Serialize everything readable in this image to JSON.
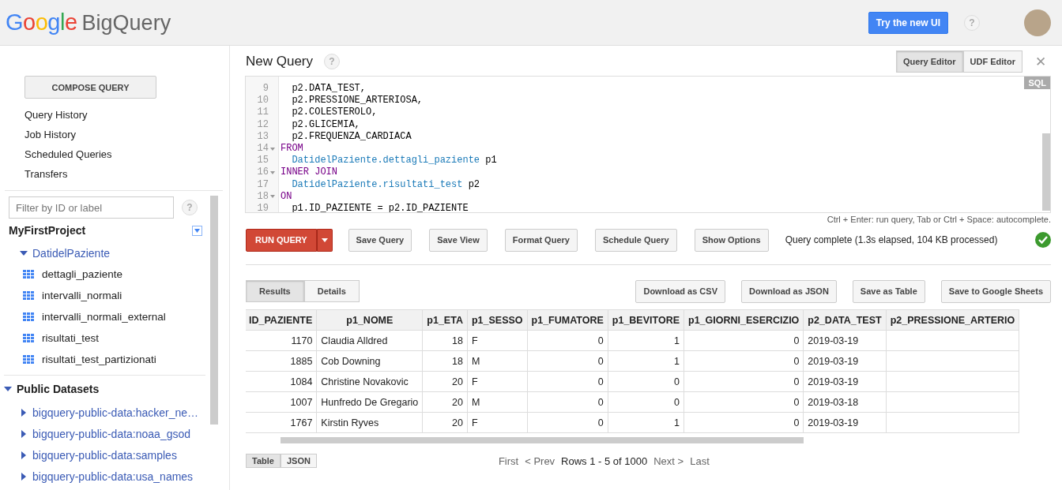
{
  "header": {
    "logo_google": "Google",
    "logo_product": "BigQuery",
    "try_button": "Try the new UI",
    "help": "?"
  },
  "sidebar": {
    "compose": "COMPOSE QUERY",
    "nav": [
      "Query History",
      "Job History",
      "Scheduled Queries",
      "Transfers"
    ],
    "filter_placeholder": "Filter by ID or label",
    "help": "?",
    "project": {
      "name": "MyFirstProject",
      "datasets": [
        {
          "name": "DatidelPaziente",
          "expanded": true,
          "tables": [
            "dettagli_paziente",
            "intervalli_normali",
            "intervalli_normali_external",
            "risultati_test",
            "risultati_test_partizionati"
          ]
        }
      ]
    },
    "public": {
      "title": "Public Datasets",
      "expanded": true,
      "datasets": [
        {
          "name": "bigquery-public-data:hacker_ne…",
          "expanded": false
        },
        {
          "name": "bigquery-public-data:noaa_gsod",
          "expanded": false
        },
        {
          "name": "bigquery-public-data:samples",
          "expanded": false
        },
        {
          "name": "bigquery-public-data:usa_names",
          "expanded": false
        }
      ]
    }
  },
  "editor": {
    "title": "New Query",
    "help": "?",
    "tabs": [
      {
        "label": "Query Editor",
        "selected": true
      },
      {
        "label": "UDF Editor",
        "selected": false
      }
    ],
    "close": "✕",
    "mode": "SQL",
    "lines": [
      {
        "n": "9",
        "fold": false,
        "parts": [
          {
            "kind": "plain",
            "text": "  p2.DATA_TEST,"
          }
        ]
      },
      {
        "n": "10",
        "fold": false,
        "parts": [
          {
            "kind": "plain",
            "text": "  p2.PRESSIONE_ARTERIOSA,"
          }
        ]
      },
      {
        "n": "11",
        "fold": false,
        "parts": [
          {
            "kind": "plain",
            "text": "  p2.COLESTEROLO,"
          }
        ]
      },
      {
        "n": "12",
        "fold": false,
        "parts": [
          {
            "kind": "plain",
            "text": "  p2.GLICEMIA,"
          }
        ]
      },
      {
        "n": "13",
        "fold": false,
        "parts": [
          {
            "kind": "plain",
            "text": "  p2.FREQUENZA_CARDIACA"
          }
        ]
      },
      {
        "n": "14",
        "fold": true,
        "parts": [
          {
            "kind": "keyword",
            "text": "FROM"
          }
        ]
      },
      {
        "n": "15",
        "fold": false,
        "parts": [
          {
            "kind": "table",
            "text": "  DatidelPaziente.dettagli_paziente"
          },
          {
            "kind": "plain",
            "text": " p1"
          }
        ]
      },
      {
        "n": "16",
        "fold": true,
        "parts": [
          {
            "kind": "keyword",
            "text": "INNER JOIN"
          }
        ]
      },
      {
        "n": "17",
        "fold": false,
        "parts": [
          {
            "kind": "table",
            "text": "  DatidelPaziente.risultati_test"
          },
          {
            "kind": "plain",
            "text": " p2"
          }
        ]
      },
      {
        "n": "18",
        "fold": true,
        "parts": [
          {
            "kind": "keyword",
            "text": "ON"
          }
        ]
      },
      {
        "n": "19",
        "fold": false,
        "parts": [
          {
            "kind": "plain",
            "text": "  p1.ID_PAZIENTE = p2.ID_PAZIENTE"
          }
        ]
      }
    ],
    "hint": "Ctrl + Enter: run query, Tab or Ctrl + Space: autocomplete.",
    "run": "RUN QUERY",
    "buttons": [
      "Save Query",
      "Save View",
      "Format Query",
      "Schedule Query",
      "Show Options"
    ],
    "status": "Query complete (1.3s elapsed, 104 KB processed)"
  },
  "results": {
    "tabs": [
      {
        "label": "Results",
        "selected": true
      },
      {
        "label": "Details",
        "selected": false
      }
    ],
    "actions": [
      "Download as CSV",
      "Download as JSON",
      "Save as Table",
      "Save to Google Sheets"
    ],
    "columns": [
      "ID_PAZIENTE",
      "p1_NOME",
      "p1_ETA",
      "p1_SESSO",
      "p1_FUMATORE",
      "p1_BEVITORE",
      "p1_GIORNI_ESERCIZIO",
      "p2_DATA_TEST",
      "p2_PRESSIONE_ARTERIO"
    ],
    "rows": [
      [
        "1170",
        "Claudia Alldred",
        "18",
        "F",
        "0",
        "1",
        "0",
        "2019-03-19"
      ],
      [
        "1885",
        "Cob Downing",
        "18",
        "M",
        "0",
        "1",
        "0",
        "2019-03-19"
      ],
      [
        "1084",
        "Christine Novakovic",
        "20",
        "F",
        "0",
        "0",
        "0",
        "2019-03-19"
      ],
      [
        "1007",
        "Hunfredo De Gregario",
        "20",
        "M",
        "0",
        "0",
        "0",
        "2019-03-18"
      ],
      [
        "1767",
        "Kirstin Ryves",
        "20",
        "F",
        "0",
        "1",
        "0",
        "2019-03-19"
      ]
    ],
    "views": [
      {
        "label": "Table",
        "selected": true
      },
      {
        "label": "JSON",
        "selected": false
      }
    ],
    "pager": {
      "first": "First",
      "prev": "< Prev",
      "range": "Rows 1 - 5 of 1000",
      "next": "Next >",
      "last": "Last"
    }
  }
}
